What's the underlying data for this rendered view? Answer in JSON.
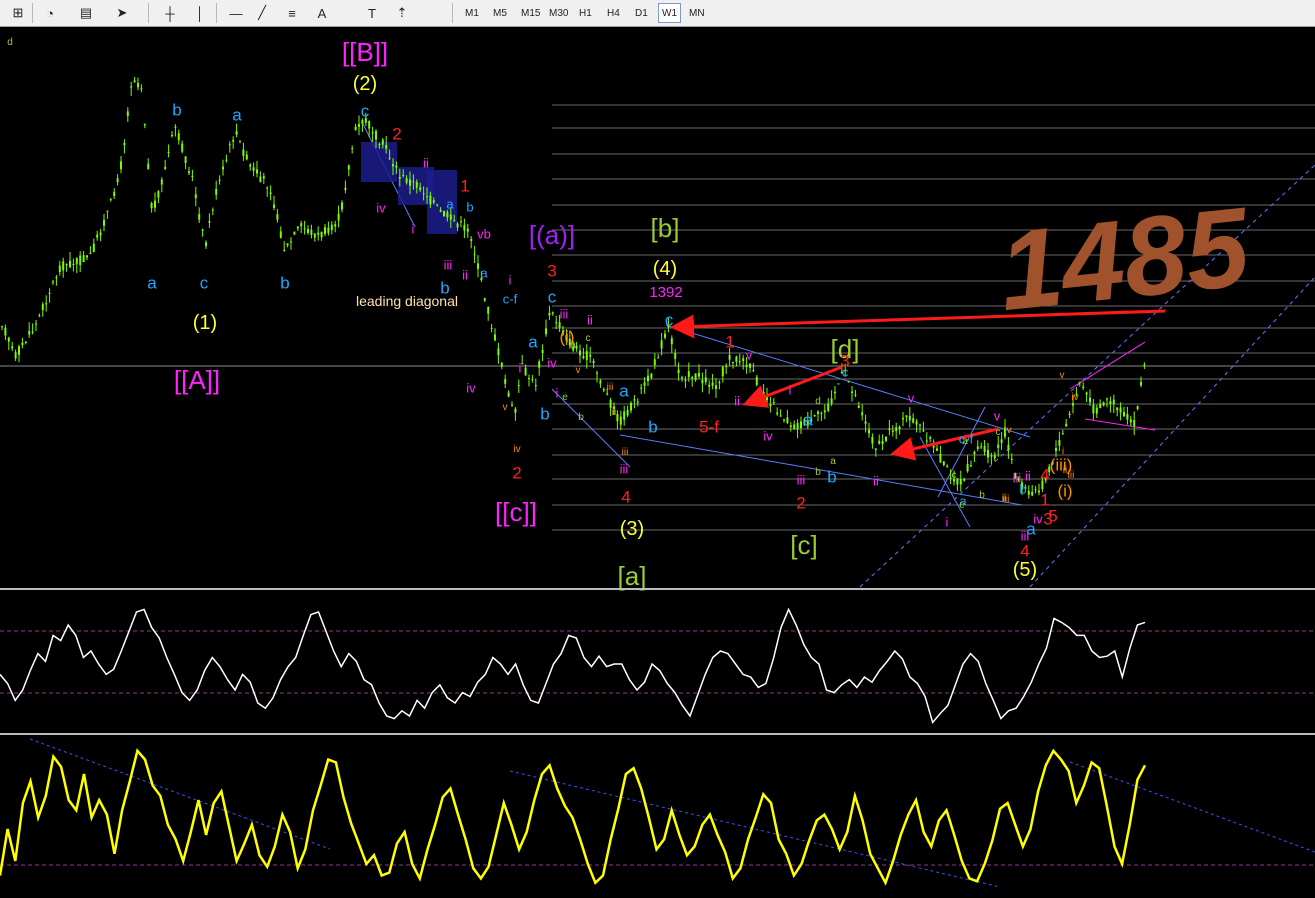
{
  "toolbar": {
    "icons": [
      "new-chart-icon",
      "history-icon",
      "templates-icon",
      "cursor-icon",
      "crosshair-icon",
      "vertical-line-icon",
      "horizontal-line-icon",
      "trendline-icon",
      "fibo-icon",
      "text-icon",
      "text-label-icon",
      "arrows-icon"
    ],
    "text_tool": "A",
    "timeframes": [
      "M1",
      "M5",
      "M15",
      "M30",
      "H1",
      "H4",
      "D1",
      "W1",
      "MN"
    ],
    "active_timeframe": "W1"
  },
  "colors": {
    "candle": "#7cfc00",
    "wave_blue": "#1ea7ff",
    "wave_red": "#ff2020",
    "wave_magenta": "#ff22ff",
    "wave_purple": "#a020f0",
    "wave_yellow": "#ffff33",
    "wave_olive": "#9acd32",
    "wave_orange": "#ff8c00",
    "note": "#a0522d",
    "indicator1": "#ffffff",
    "indicator2": "#ffff00"
  },
  "chart_data": [
    {
      "type": "line",
      "title": "",
      "xlabel": "",
      "ylabel": "",
      "grid": false,
      "note_text": "1485",
      "annotation_price": "1392",
      "annotation_leading": "leading diagonal",
      "labels": [
        {
          "text": "[[A]]",
          "color": "wave_magenta",
          "size": "xl"
        },
        {
          "text": "[[B]]",
          "color": "wave_magenta",
          "size": "xl"
        },
        {
          "text": "[[c]]",
          "color": "wave_magenta",
          "size": "xl"
        },
        {
          "text": "(1)",
          "color": "wave_yellow",
          "size": "l"
        },
        {
          "text": "(2)",
          "color": "wave_yellow",
          "size": "l"
        },
        {
          "text": "(3)",
          "color": "wave_yellow",
          "size": "l"
        },
        {
          "text": "(4)",
          "color": "wave_yellow",
          "size": "l"
        },
        {
          "text": "(5)",
          "color": "wave_yellow",
          "size": "l"
        },
        {
          "text": "[(a)]",
          "color": "wave_purple",
          "size": "xl"
        },
        {
          "text": "[b]",
          "color": "wave_olive",
          "size": "xl"
        },
        {
          "text": "[a]",
          "color": "wave_olive",
          "size": "xl"
        },
        {
          "text": "[c]",
          "color": "wave_olive",
          "size": "xl"
        },
        {
          "text": "[d]",
          "color": "wave_olive",
          "size": "xl"
        },
        {
          "text": "b",
          "color": "wave_blue",
          "size": "m"
        },
        {
          "text": "a",
          "color": "wave_blue",
          "size": "m"
        },
        {
          "text": "a",
          "color": "wave_blue",
          "size": "m"
        },
        {
          "text": "c",
          "color": "wave_blue",
          "size": "m"
        },
        {
          "text": "b",
          "color": "wave_blue",
          "size": "m"
        },
        {
          "text": "c",
          "color": "wave_blue",
          "size": "m"
        },
        {
          "text": "c",
          "color": "wave_blue",
          "size": "m"
        },
        {
          "text": "c",
          "color": "wave_blue",
          "size": "m"
        },
        {
          "text": "a",
          "color": "wave_blue",
          "size": "m"
        },
        {
          "text": "b",
          "color": "wave_blue",
          "size": "m"
        },
        {
          "text": "a",
          "color": "wave_blue",
          "size": "m"
        },
        {
          "text": "b",
          "color": "wave_blue",
          "size": "m"
        },
        {
          "text": "a",
          "color": "wave_blue",
          "size": "m"
        },
        {
          "text": "b",
          "color": "wave_blue",
          "size": "m"
        },
        {
          "text": "c",
          "color": "wave_blue",
          "size": "s"
        },
        {
          "text": "a",
          "color": "wave_blue",
          "size": "s"
        },
        {
          "text": "a",
          "color": "wave_blue",
          "size": "s"
        },
        {
          "text": "b",
          "color": "wave_blue",
          "size": "s"
        },
        {
          "text": "c-f",
          "color": "wave_blue",
          "size": "s"
        },
        {
          "text": "c-f",
          "color": "wave_blue",
          "size": "s"
        },
        {
          "text": "a",
          "color": "wave_blue",
          "size": "s"
        },
        {
          "text": "b",
          "color": "wave_blue",
          "size": "s"
        },
        {
          "text": "a",
          "color": "wave_blue",
          "size": "m"
        },
        {
          "text": "b",
          "color": "wave_blue",
          "size": "m"
        },
        {
          "text": "1",
          "color": "wave_red",
          "size": "m"
        },
        {
          "text": "2",
          "color": "wave_red",
          "size": "m"
        },
        {
          "text": "3",
          "color": "wave_red",
          "size": "m"
        },
        {
          "text": "4",
          "color": "wave_red",
          "size": "m"
        },
        {
          "text": "5-f",
          "color": "wave_red",
          "size": "m"
        },
        {
          "text": "1",
          "color": "wave_red",
          "size": "m"
        },
        {
          "text": "2",
          "color": "wave_red",
          "size": "m"
        },
        {
          "text": "3",
          "color": "wave_red",
          "size": "m"
        },
        {
          "text": "4",
          "color": "wave_red",
          "size": "m"
        },
        {
          "text": "1",
          "color": "wave_red",
          "size": "m"
        },
        {
          "text": "3",
          "color": "wave_red",
          "size": "m"
        },
        {
          "text": "4",
          "color": "wave_red",
          "size": "m"
        },
        {
          "text": "5",
          "color": "wave_red",
          "size": "m"
        },
        {
          "text": "2",
          "color": "wave_red",
          "size": "m"
        },
        {
          "text": "ii",
          "color": "wave_magenta",
          "size": "s"
        },
        {
          "text": "iv",
          "color": "wave_magenta",
          "size": "s"
        },
        {
          "text": "i",
          "color": "wave_magenta",
          "size": "s"
        },
        {
          "text": "iii",
          "color": "wave_magenta",
          "size": "s"
        },
        {
          "text": "vb",
          "color": "wave_magenta",
          "size": "s"
        },
        {
          "text": "ii",
          "color": "wave_magenta",
          "size": "s"
        },
        {
          "text": "i",
          "color": "wave_magenta",
          "size": "s"
        },
        {
          "text": "iv",
          "color": "wave_magenta",
          "size": "s"
        },
        {
          "text": "iii",
          "color": "wave_magenta",
          "size": "s"
        },
        {
          "text": "ii",
          "color": "wave_magenta",
          "size": "s"
        },
        {
          "text": "iv",
          "color": "wave_magenta",
          "size": "s"
        },
        {
          "text": "i",
          "color": "wave_magenta",
          "size": "s"
        },
        {
          "text": "iii",
          "color": "wave_magenta",
          "size": "s"
        },
        {
          "text": "v",
          "color": "wave_magenta",
          "size": "s"
        },
        {
          "text": "ii",
          "color": "wave_magenta",
          "size": "s"
        },
        {
          "text": "i",
          "color": "wave_magenta",
          "size": "s"
        },
        {
          "text": "iv",
          "color": "wave_magenta",
          "size": "s"
        },
        {
          "text": "iii",
          "color": "wave_magenta",
          "size": "s"
        },
        {
          "text": "v",
          "color": "wave_magenta",
          "size": "s"
        },
        {
          "text": "ii",
          "color": "wave_magenta",
          "size": "s"
        },
        {
          "text": "i",
          "color": "wave_magenta",
          "size": "s"
        },
        {
          "text": "iii",
          "color": "wave_magenta",
          "size": "s"
        },
        {
          "text": "v",
          "color": "wave_magenta",
          "size": "s"
        },
        {
          "text": "ii",
          "color": "wave_magenta",
          "size": "s"
        },
        {
          "text": "iv",
          "color": "wave_magenta",
          "size": "s"
        },
        {
          "text": "iii",
          "color": "wave_magenta",
          "size": "s"
        },
        {
          "text": "i",
          "color": "wave_magenta",
          "size": "s"
        },
        {
          "text": "iv",
          "color": "wave_orange",
          "size": "xs"
        },
        {
          "text": "v",
          "color": "wave_orange",
          "size": "xs"
        },
        {
          "text": "iii",
          "color": "wave_orange",
          "size": "xs"
        },
        {
          "text": "iii",
          "color": "wave_orange",
          "size": "xs"
        },
        {
          "text": "v",
          "color": "wave_orange",
          "size": "xs"
        },
        {
          "text": "ii",
          "color": "wave_orange",
          "size": "xs"
        },
        {
          "text": "iv",
          "color": "wave_orange",
          "size": "xs"
        },
        {
          "text": "ii",
          "color": "wave_orange",
          "size": "xs"
        },
        {
          "text": "iii",
          "color": "wave_orange",
          "size": "xs"
        },
        {
          "text": "iv",
          "color": "wave_orange",
          "size": "xs"
        },
        {
          "text": "ii",
          "color": "wave_orange",
          "size": "xs"
        },
        {
          "text": "i",
          "color": "wave_orange",
          "size": "xs"
        },
        {
          "text": "iii",
          "color": "wave_orange",
          "size": "xs"
        },
        {
          "text": "v",
          "color": "wave_orange",
          "size": "xs"
        },
        {
          "text": "(iii)",
          "color": "wave_orange",
          "size": "m"
        },
        {
          "text": "(i)",
          "color": "wave_orange",
          "size": "m"
        },
        {
          "text": "(i)",
          "color": "wave_orange",
          "size": "m"
        },
        {
          "text": "a",
          "color": "wave_olive",
          "size": "xs"
        },
        {
          "text": "c",
          "color": "wave_olive",
          "size": "xs"
        },
        {
          "text": "e",
          "color": "wave_olive",
          "size": "xs"
        },
        {
          "text": "b",
          "color": "wave_olive",
          "size": "xs"
        },
        {
          "text": "d",
          "color": "wave_olive",
          "size": "xs"
        },
        {
          "text": "b",
          "color": "wave_olive",
          "size": "xs"
        },
        {
          "text": "a",
          "color": "wave_olive",
          "size": "xs"
        },
        {
          "text": "c",
          "color": "wave_olive",
          "size": "xs"
        },
        {
          "text": "a",
          "color": "wave_olive",
          "size": "xs"
        },
        {
          "text": "c",
          "color": "wave_olive",
          "size": "xs"
        },
        {
          "text": "e",
          "color": "wave_olive",
          "size": "xs"
        },
        {
          "text": "b",
          "color": "wave_olive",
          "size": "xs"
        },
        {
          "text": "d",
          "color": "wave_olive",
          "size": "xs"
        }
      ]
    },
    {
      "type": "line",
      "title": "",
      "grid": false,
      "series": [
        {
          "values": [
            0.42,
            0.35,
            0.22,
            0.3,
            0.45,
            0.58,
            0.52,
            0.72,
            0.68,
            0.8,
            0.72,
            0.55,
            0.6,
            0.5,
            0.42,
            0.46,
            0.6,
            0.75,
            0.9,
            0.92,
            0.78,
            0.7,
            0.55,
            0.42,
            0.28,
            0.22,
            0.3,
            0.45,
            0.55,
            0.48,
            0.38,
            0.3,
            0.42,
            0.36,
            0.2,
            0.16,
            0.24,
            0.38,
            0.48,
            0.55,
            0.72,
            0.88,
            0.9,
            0.75,
            0.6,
            0.48,
            0.58,
            0.52,
            0.38,
            0.34,
            0.2,
            0.1,
            0.08,
            0.14,
            0.1,
            0.22,
            0.16,
            0.28,
            0.34,
            0.24,
            0.2,
            0.28,
            0.25,
            0.36,
            0.42,
            0.55,
            0.5,
            0.42,
            0.5,
            0.34,
            0.22,
            0.2,
            0.35,
            0.5,
            0.58,
            0.72,
            0.7,
            0.55,
            0.48,
            0.56,
            0.48,
            0.5,
            0.5,
            0.38,
            0.3,
            0.36,
            0.5,
            0.45,
            0.35,
            0.28,
            0.18,
            0.1,
            0.26,
            0.42,
            0.55,
            0.6,
            0.58,
            0.5,
            0.42,
            0.4,
            0.32,
            0.35,
            0.54,
            0.78,
            0.92,
            0.8,
            0.65,
            0.55,
            0.5,
            0.3,
            0.28,
            0.34,
            0.38,
            0.32,
            0.4,
            0.36,
            0.45,
            0.52,
            0.6,
            0.54,
            0.4,
            0.35,
            0.25,
            0.05,
            0.12,
            0.18,
            0.34,
            0.5,
            0.58,
            0.52,
            0.35,
            0.22,
            0.08,
            0.14,
            0.16,
            0.25,
            0.36,
            0.5,
            0.62,
            0.85,
            0.82,
            0.78,
            0.72,
            0.72,
            0.6,
            0.55,
            0.56,
            0.6,
            0.4,
            0.62,
            0.8,
            0.82
          ]
        }
      ]
    },
    {
      "type": "line",
      "title": "",
      "grid": false,
      "series": [
        {
          "values": [
            0.1,
            0.42,
            0.2,
            0.6,
            0.75,
            0.5,
            0.65,
            0.92,
            0.85,
            0.62,
            0.55,
            0.8,
            0.5,
            0.62,
            0.52,
            0.25,
            0.55,
            0.75,
            0.96,
            0.9,
            0.72,
            0.65,
            0.45,
            0.35,
            0.2,
            0.4,
            0.62,
            0.38,
            0.6,
            0.68,
            0.44,
            0.2,
            0.32,
            0.45,
            0.24,
            0.16,
            0.3,
            0.52,
            0.4,
            0.15,
            0.28,
            0.55,
            0.72,
            0.9,
            0.88,
            0.64,
            0.46,
            0.32,
            0.18,
            0.24,
            0.1,
            0.12,
            0.32,
            0.4,
            0.18,
            0.08,
            0.28,
            0.45,
            0.64,
            0.7,
            0.52,
            0.35,
            0.15,
            0.08,
            0.16,
            0.38,
            0.6,
            0.45,
            0.28,
            0.4,
            0.62,
            0.8,
            0.86,
            0.7,
            0.58,
            0.5,
            0.35,
            0.18,
            0.05,
            0.1,
            0.35,
            0.56,
            0.8,
            0.84,
            0.7,
            0.5,
            0.28,
            0.35,
            0.55,
            0.38,
            0.24,
            0.3,
            0.45,
            0.52,
            0.38,
            0.26,
            0.08,
            0.15,
            0.35,
            0.5,
            0.66,
            0.6,
            0.35,
            0.25,
            0.1,
            0.18,
            0.34,
            0.48,
            0.52,
            0.42,
            0.28,
            0.4,
            0.65,
            0.48,
            0.25,
            0.15,
            0.05,
            0.2,
            0.38,
            0.52,
            0.62,
            0.4,
            0.3,
            0.48,
            0.55,
            0.38,
            0.2,
            0.08,
            0.06,
            0.18,
            0.34,
            0.56,
            0.6,
            0.45,
            0.3,
            0.42,
            0.68,
            0.86,
            0.96,
            0.9,
            0.82,
            0.6,
            0.72,
            0.88,
            0.84,
            0.58,
            0.3,
            0.18,
            0.45,
            0.76,
            0.86
          ]
        }
      ]
    }
  ]
}
